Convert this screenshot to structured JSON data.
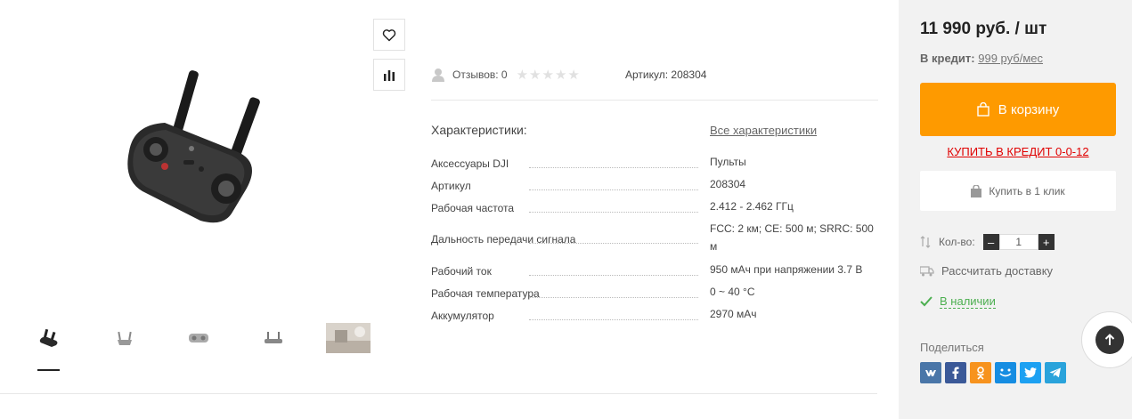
{
  "meta": {
    "reviews_label": "Отзывов: 0",
    "article_label": "Артикул: 208304",
    "rating_stars": 0
  },
  "specs": {
    "heading": "Характеристики:",
    "all_link": "Все характеристики",
    "rows": [
      {
        "name": "Аксессуары DJI",
        "value": "Пульты"
      },
      {
        "name": "Артикул",
        "value": "208304"
      },
      {
        "name": "Рабочая частота",
        "value": "2.412 - 2.462 ГГц"
      },
      {
        "name": "Дальность передачи сигнала",
        "value": "FCC: 2 км; CE: 500 м; SRRC: 500 м"
      },
      {
        "name": "Рабочий ток",
        "value": "950 мАч при напряжении 3.7 В"
      },
      {
        "name": "Рабочая температура",
        "value": "0 ~ 40 °C"
      },
      {
        "name": "Аккумулятор",
        "value": "2970 мАч"
      }
    ]
  },
  "buy": {
    "price": "11 990 руб. / шт",
    "credit_label": "В кредит:",
    "credit_value": "999 руб/мес",
    "cart_label": "В корзину",
    "credit_link": "КУПИТЬ В КРЕДИТ 0-0-12",
    "oneclick_label": "Купить в 1 клик",
    "qty_label": "Кол-во:",
    "qty_value": "1",
    "minus": "–",
    "plus": "+",
    "delivery_label": "Рассчитать доставку",
    "stock_label": "В наличии",
    "share_label": "Поделиться"
  },
  "colors": {
    "accent": "#fe9a00",
    "credit_red": "#e00000",
    "stock_green": "#4caf50",
    "vk": "#4a76a8",
    "fb": "#3b5998",
    "ok": "#f7931e",
    "mm": "#168de2",
    "tw": "#1da1f2",
    "tg": "#2aa3db"
  },
  "social": [
    {
      "name": "vk-icon",
      "glyph": "vk"
    },
    {
      "name": "facebook-icon",
      "glyph": "f"
    },
    {
      "name": "odnoklassniki-icon",
      "glyph": "ok"
    },
    {
      "name": "moimir-icon",
      "glyph": "mm"
    },
    {
      "name": "twitter-icon",
      "glyph": "tw"
    },
    {
      "name": "telegram-icon",
      "glyph": "tg"
    }
  ]
}
